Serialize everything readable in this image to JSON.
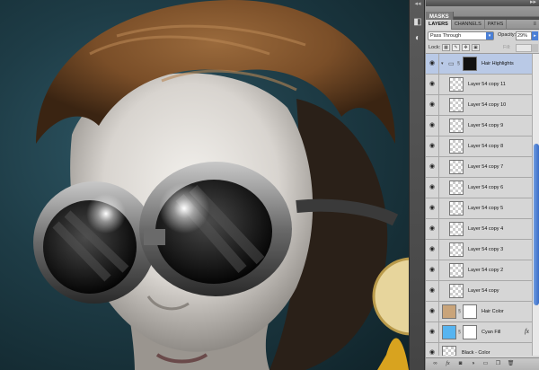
{
  "panel": {
    "masks_tab": "MASKS",
    "tabs": [
      {
        "label": "LAYERS",
        "active": true
      },
      {
        "label": "CHANNELS",
        "active": false
      },
      {
        "label": "PATHS",
        "active": false
      }
    ],
    "blend_mode": "Pass Through",
    "opacity_label": "Opacity:",
    "opacity_value": "29%",
    "lock_label": "Lock:",
    "fill_label": "Fill:"
  },
  "layers": [
    {
      "name": "Hair Highlights",
      "kind": "group",
      "selected": true
    },
    {
      "name": "Layer 54 copy 11",
      "kind": "layer"
    },
    {
      "name": "Layer 54 copy 10",
      "kind": "layer"
    },
    {
      "name": "Layer 54 copy 9",
      "kind": "layer"
    },
    {
      "name": "Layer 54 copy 8",
      "kind": "layer"
    },
    {
      "name": "Layer 54 copy 7",
      "kind": "layer"
    },
    {
      "name": "Layer 54 copy 6",
      "kind": "layer"
    },
    {
      "name": "Layer 54 copy 5",
      "kind": "layer"
    },
    {
      "name": "Layer 54 copy 4",
      "kind": "layer"
    },
    {
      "name": "Layer 54 copy 3",
      "kind": "layer"
    },
    {
      "name": "Layer 54 copy 2",
      "kind": "layer"
    },
    {
      "name": "Layer 54 copy",
      "kind": "layer"
    },
    {
      "name": "Hair Color",
      "kind": "masked"
    },
    {
      "name": "Cyan Fill",
      "kind": "fill"
    },
    {
      "name": "Black - Color",
      "kind": "layer"
    }
  ],
  "colors": {
    "selection": "#b9c9e6",
    "cyan_fill": "#56b4f0",
    "accent": "#3a6dc6"
  }
}
